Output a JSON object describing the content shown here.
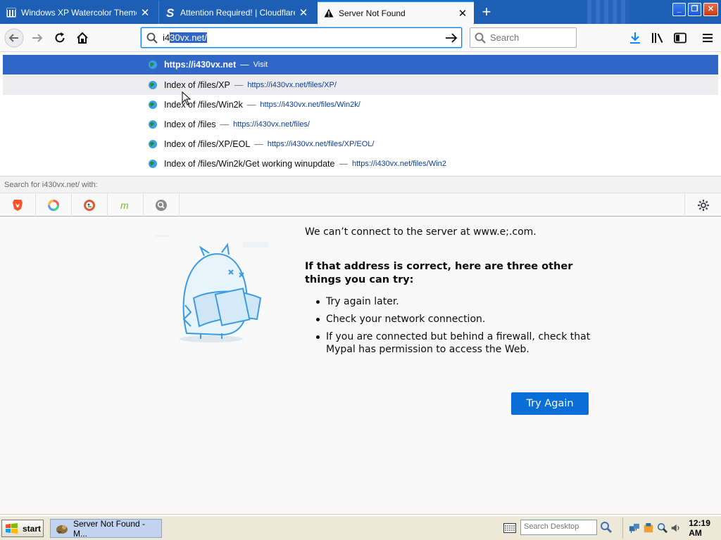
{
  "tabs": [
    {
      "title": "Windows XP Watercolor Theme : F",
      "icon": "archive-icon",
      "active": false
    },
    {
      "title": "Attention Required! | Cloudflare",
      "icon": "s-logo-icon",
      "active": false
    },
    {
      "title": "Server Not Found",
      "icon": "warning-icon",
      "active": true
    }
  ],
  "urlbar": {
    "typed": "i4",
    "selected": "30vx.net/"
  },
  "search": {
    "placeholder": "Search"
  },
  "autocomplete": {
    "rows": [
      {
        "title": "https://i430vx.net",
        "action": "Visit",
        "url": ""
      },
      {
        "title": "Index of /files/XP",
        "url": "https://i430vx.net/files/XP/"
      },
      {
        "title": "Index of /files/Win2k",
        "url": "https://i430vx.net/files/Win2k/"
      },
      {
        "title": "Index of /files",
        "url": "https://i430vx.net/files/"
      },
      {
        "title": "Index of /files/XP/EOL",
        "url": "https://i430vx.net/files/XP/EOL/"
      },
      {
        "title": "Index of /files/Win2k/Get working winupdate",
        "url": "https://i430vx.net/files/Win2"
      }
    ],
    "dash": "—",
    "search_for": "Search for i430vx.net/ with:",
    "engines": [
      "brave-icon",
      "qwant-icon",
      "duckduckgo-icon",
      "mojeek-icon",
      "search-engine-icon"
    ]
  },
  "error": {
    "description": "We can’t connect to the server at www.e;.com.",
    "title": "If that address is correct, here are three other things you can try:",
    "tips": [
      "Try again later.",
      "Check your network connection.",
      "If you are connected but behind a firewall, check that Mypal has permission to access the Web."
    ],
    "button": "Try Again"
  },
  "taskbar": {
    "start": "start",
    "task": "Server Not Found - M...",
    "search_placeholder": "Search Desktop",
    "clock": "12:19 AM"
  },
  "colors": {
    "accent": "#0a84ff",
    "selected_row": "#3067c6",
    "titlebar": "#1d5fb4",
    "button": "#0a6ed8"
  }
}
